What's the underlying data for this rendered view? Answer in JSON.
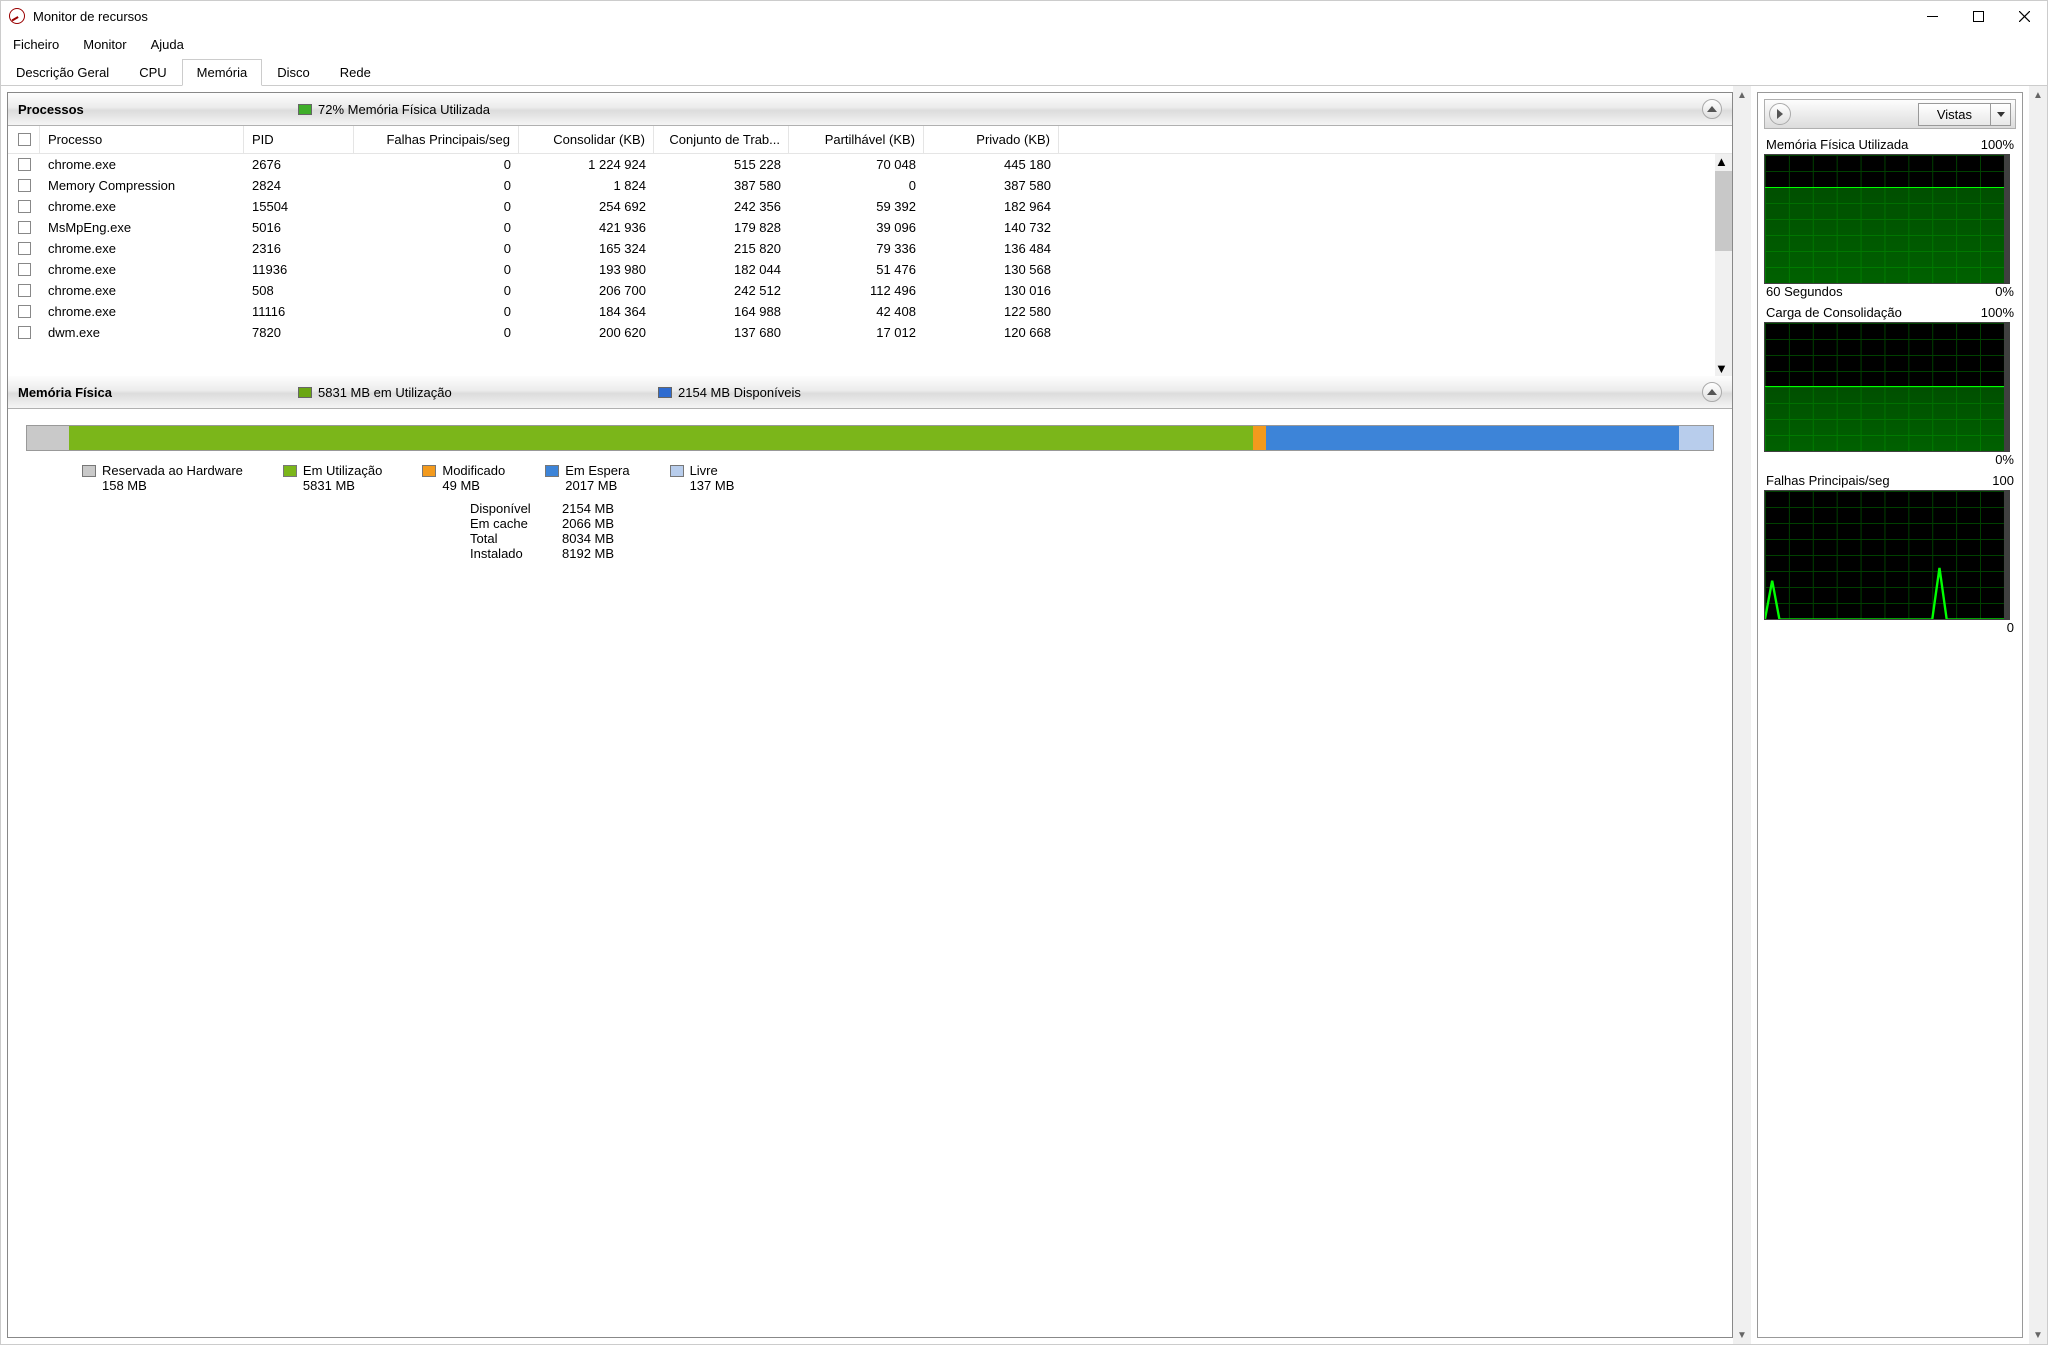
{
  "window": {
    "title": "Monitor de recursos"
  },
  "menu": {
    "file": "Ficheiro",
    "monitor": "Monitor",
    "help": "Ajuda"
  },
  "tabs": {
    "overview": "Descrição Geral",
    "cpu": "CPU",
    "memory": "Memória",
    "disk": "Disco",
    "network": "Rede"
  },
  "processes": {
    "title": "Processos",
    "summary": "72% Memória Física Utilizada",
    "swatch": "#3fae2a",
    "columns": {
      "process": "Processo",
      "pid": "PID",
      "faults": "Falhas Principais/seg",
      "commit": "Consolidar (KB)",
      "ws": "Conjunto de Trab...",
      "share": "Partilhável (KB)",
      "priv": "Privado (KB)"
    },
    "rows": [
      {
        "name": "chrome.exe",
        "pid": "2676",
        "faults": "0",
        "commit": "1 224 924",
        "ws": "515 228",
        "share": "70 048",
        "priv": "445 180"
      },
      {
        "name": "Memory Compression",
        "pid": "2824",
        "faults": "0",
        "commit": "1 824",
        "ws": "387 580",
        "share": "0",
        "priv": "387 580"
      },
      {
        "name": "chrome.exe",
        "pid": "15504",
        "faults": "0",
        "commit": "254 692",
        "ws": "242 356",
        "share": "59 392",
        "priv": "182 964"
      },
      {
        "name": "MsMpEng.exe",
        "pid": "5016",
        "faults": "0",
        "commit": "421 936",
        "ws": "179 828",
        "share": "39 096",
        "priv": "140 732"
      },
      {
        "name": "chrome.exe",
        "pid": "2316",
        "faults": "0",
        "commit": "165 324",
        "ws": "215 820",
        "share": "79 336",
        "priv": "136 484"
      },
      {
        "name": "chrome.exe",
        "pid": "11936",
        "faults": "0",
        "commit": "193 980",
        "ws": "182 044",
        "share": "51 476",
        "priv": "130 568"
      },
      {
        "name": "chrome.exe",
        "pid": "508",
        "faults": "0",
        "commit": "206 700",
        "ws": "242 512",
        "share": "112 496",
        "priv": "130 016"
      },
      {
        "name": "chrome.exe",
        "pid": "11116",
        "faults": "0",
        "commit": "184 364",
        "ws": "164 988",
        "share": "42 408",
        "priv": "122 580"
      },
      {
        "name": "dwm.exe",
        "pid": "7820",
        "faults": "0",
        "commit": "200 620",
        "ws": "137 680",
        "share": "17 012",
        "priv": "120 668"
      }
    ]
  },
  "physical": {
    "title": "Memória Física",
    "inuse": "5831 MB em Utilização",
    "inuse_sw": "#6aa612",
    "avail": "2154 MB Disponíveis",
    "avail_sw": "#2e6bd0",
    "segments": [
      {
        "color": "#c9c9c9",
        "pct": 2.5
      },
      {
        "color": "#7bb61a",
        "pct": 70.2
      },
      {
        "color": "#f39a1d",
        "pct": 0.8
      },
      {
        "color": "#3d84d8",
        "pct": 24.5
      },
      {
        "color": "#b8cdec",
        "pct": 2.0
      }
    ],
    "legend": [
      {
        "label": "Reservada ao Hardware",
        "value": "158 MB",
        "color": "#c9c9c9"
      },
      {
        "label": "Em Utilização",
        "value": "5831 MB",
        "color": "#7bb61a"
      },
      {
        "label": "Modificado",
        "value": "49 MB",
        "color": "#f39a1d"
      },
      {
        "label": "Em Espera",
        "value": "2017 MB",
        "color": "#3d84d8"
      },
      {
        "label": "Livre",
        "value": "137 MB",
        "color": "#b8cdec"
      }
    ],
    "stats": [
      {
        "k": "Disponível",
        "v": "2154 MB"
      },
      {
        "k": "Em cache",
        "v": "2066 MB"
      },
      {
        "k": "Total",
        "v": "8034 MB"
      },
      {
        "k": "Instalado",
        "v": "8192 MB"
      }
    ]
  },
  "sidebar": {
    "views": "Vistas",
    "graphs": [
      {
        "top_l": "Memória Física Utilizada",
        "top_r": "100%",
        "bot_l": "60 Segundos",
        "bot_r": "0%",
        "fill": 74
      },
      {
        "top_l": "Carga de Consolidação",
        "top_r": "100%",
        "bot_l": "",
        "bot_r": "0%",
        "fill": 50
      },
      {
        "top_l": "Falhas Principais/seg",
        "top_r": "100",
        "bot_l": "",
        "bot_r": "0",
        "fill": 0
      }
    ]
  }
}
